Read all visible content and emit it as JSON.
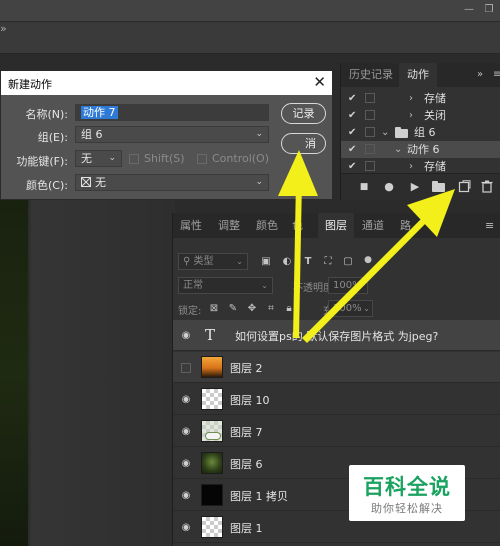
{
  "dialog": {
    "title": "新建动作",
    "name_label": "名称(N):",
    "name_value": "动作 7",
    "set_label": "组(E):",
    "set_value": "组 6",
    "fkey_label": "功能键(F):",
    "fkey_value": "无",
    "shift_label": "Shift(S)",
    "control_label": "Control(O)",
    "color_label": "颜色(C):",
    "color_value": "无",
    "record_button": "记录",
    "cancel_partial": "消"
  },
  "actions_panel": {
    "tabs": [
      "历史记录",
      "动作"
    ],
    "active_tab": 1,
    "rows": [
      {
        "label": "存储",
        "checked": true,
        "sel": false
      },
      {
        "label": "关闭",
        "checked": true,
        "sel": false
      },
      {
        "label": "组 6",
        "checked": true,
        "sel": false
      },
      {
        "label": "动作 6",
        "checked": true,
        "sel": true
      },
      {
        "label": "存储",
        "checked": true,
        "sel": false
      }
    ]
  },
  "layers_panel": {
    "tabs": [
      "属性",
      "调整",
      "颜色",
      "色",
      "图层",
      "通道",
      "路"
    ],
    "active_tab": 4,
    "filter_label": "类型",
    "blend_mode": "正常",
    "opacity_label": "不透明度:",
    "opacity_value": "100%",
    "lock_label": "锁定:",
    "fill_label": "充:",
    "fill_value": "100%",
    "layers": [
      {
        "name": "如何设置ps的 默认保存图片格式 为jpeg?",
        "kind": "text",
        "visible": true,
        "selected": true
      },
      {
        "name": "图层 2",
        "kind": "photo",
        "visible": false,
        "selected": false
      },
      {
        "name": "图层 10",
        "kind": "transparent",
        "visible": true,
        "selected": false
      },
      {
        "name": "图层 7",
        "kind": "flowers",
        "visible": true,
        "selected": false
      },
      {
        "name": "图层 6",
        "kind": "green",
        "visible": true,
        "selected": false
      },
      {
        "name": "图层 1 拷贝",
        "kind": "black",
        "visible": true,
        "selected": false
      },
      {
        "name": "图层 1",
        "kind": "transparent",
        "visible": true,
        "selected": false
      }
    ]
  },
  "watermark": {
    "title": "百科全说",
    "subtitle": "助你轻松解决"
  },
  "colors": {
    "arrow": "#f3ef1a",
    "selection": "#2f7ad6",
    "watermark_green": "#1aa260"
  }
}
